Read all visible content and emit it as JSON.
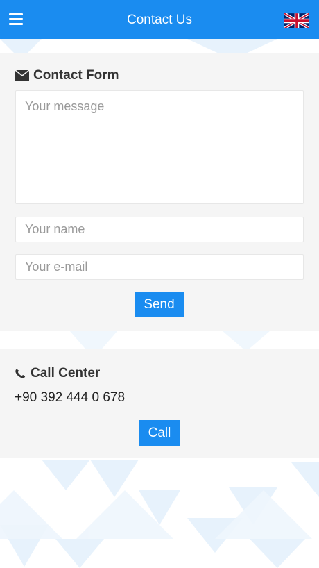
{
  "header": {
    "title": "Contact Us",
    "menu_icon": "hamburger-menu-icon",
    "language_icon": "uk-flag-icon"
  },
  "contact_form": {
    "heading": "Contact Form",
    "heading_icon": "envelope-icon",
    "message_placeholder": "Your message",
    "name_placeholder": "Your name",
    "email_placeholder": "Your e-mail",
    "send_label": "Send"
  },
  "call_center": {
    "heading": "Call Center",
    "heading_icon": "phone-icon",
    "phone": "+90 392 444 0 678",
    "call_label": "Call"
  },
  "colors": {
    "accent": "#1a8cf0",
    "section_bg": "#f5f5f5",
    "text": "#333333"
  }
}
